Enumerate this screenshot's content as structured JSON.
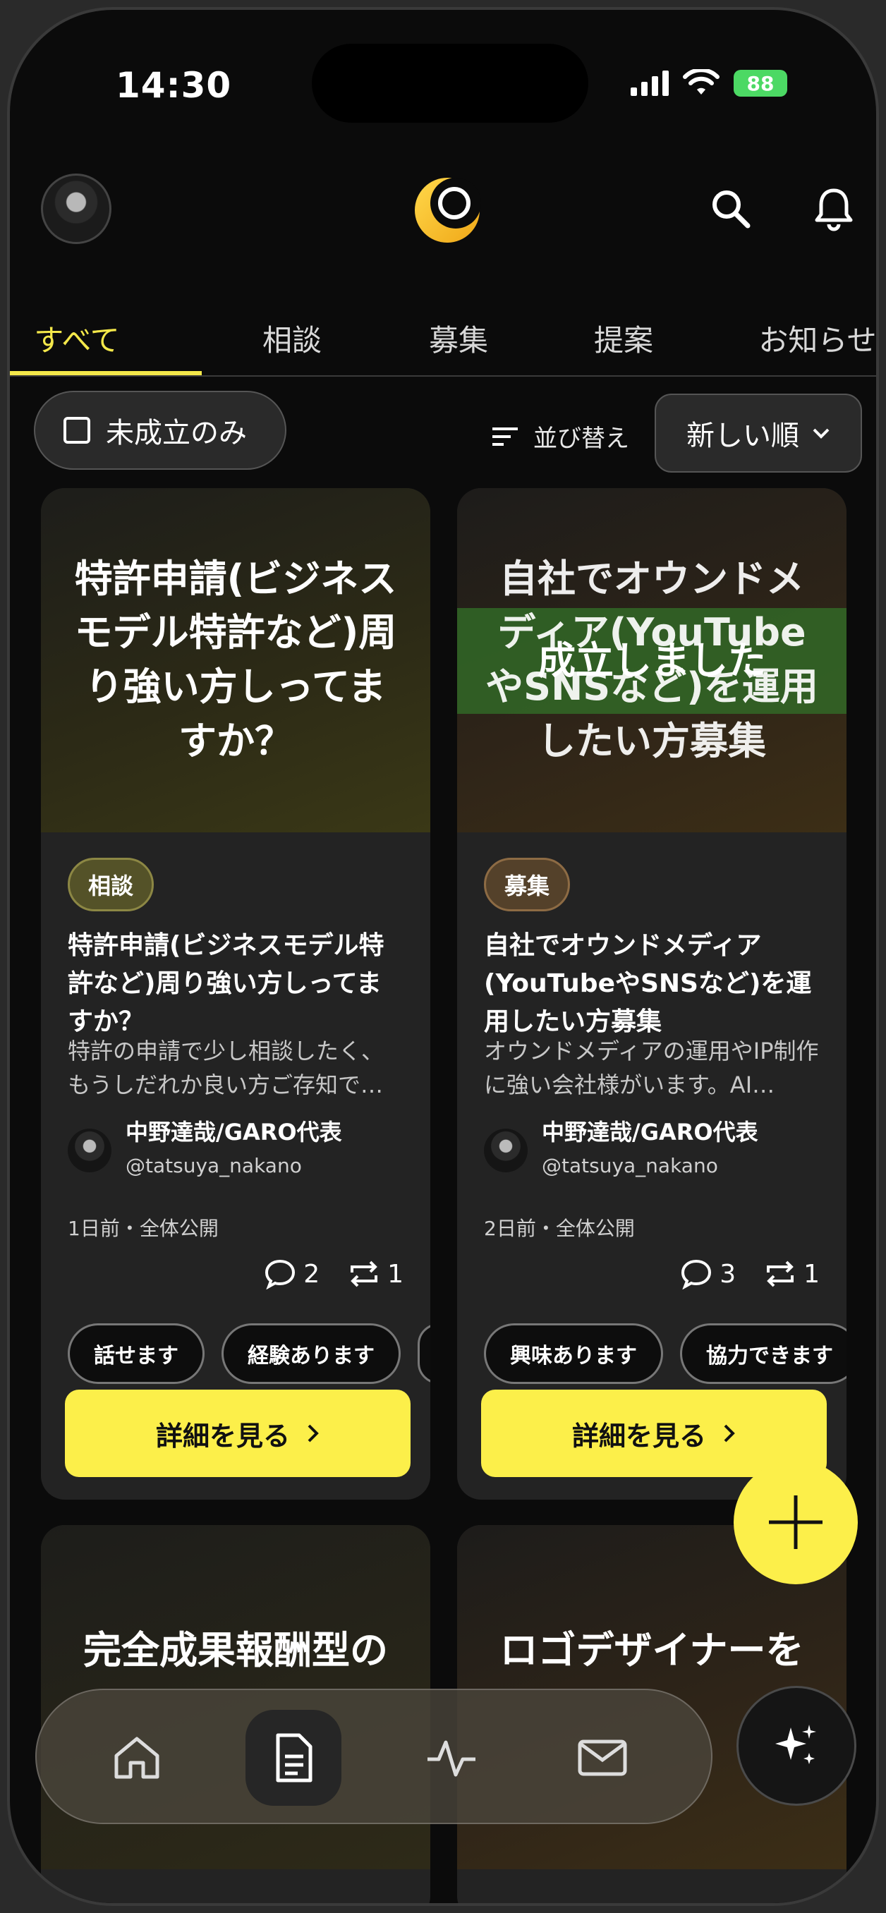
{
  "status_bar": {
    "time": "14:30",
    "battery": "88"
  },
  "header": {
    "avatar_icon": "user-avatar",
    "logo_icon": "crescent-moon-logo",
    "search_icon": "search-icon",
    "bell_icon": "bell-icon"
  },
  "tabs": [
    {
      "label": "すべて",
      "active": true
    },
    {
      "label": "相談"
    },
    {
      "label": "募集"
    },
    {
      "label": "提案"
    },
    {
      "label": "お知らせ"
    }
  ],
  "filter": {
    "label": "未成立のみ",
    "sort_label": "並び替え",
    "sort_value": "新しい順"
  },
  "cards": [
    {
      "hero_title": "特許申請(ビジネスモデル特許など)周り強い方しってますか？",
      "tag": "相談",
      "title": "特許申請(ビジネスモデル特許など)周り強い方しってますか？",
      "desc": "特許の申請で少し相談したく、もうしだれか良い方ご存知で…",
      "author_name": "中野達哉/GARO代表",
      "author_handle": "@tatsuya_nakano",
      "meta": "1日前・全体公開",
      "comments": "2",
      "reposts": "1",
      "chips": [
        "話せます",
        "経験あります"
      ],
      "button": "詳細を見る"
    },
    {
      "hero_title": "自社でオウンドメディア(YouTubeやSNSなど)を運用したい方募集",
      "overlay": "成立しました",
      "tag": "募集",
      "title": "自社でオウンドメディア(YouTubeやSNSなど)を運用したい方募集",
      "desc": "オウンドメディアの運用やIP制作に強い会社様がいます。AI…",
      "author_name": "中野達哉/GARO代表",
      "author_handle": "@tatsuya_nakano",
      "meta": "2日前・全体公開",
      "comments": "3",
      "reposts": "1",
      "chips": [
        "興味あります",
        "協力できます"
      ],
      "button": "詳細を見る"
    },
    {
      "hero_title": "完全成果報酬型の"
    },
    {
      "hero_title": "ロゴデザイナーを"
    }
  ],
  "bottom_nav": [
    {
      "icon": "home-icon"
    },
    {
      "icon": "document-icon",
      "active": true
    },
    {
      "icon": "activity-icon"
    },
    {
      "icon": "mail-icon"
    }
  ],
  "ai_button_icon": "sparkles-icon",
  "fab_icon": "plus-icon",
  "colors": {
    "accent": "#fcef4a",
    "background": "#0b0b0b",
    "card": "#232323"
  }
}
